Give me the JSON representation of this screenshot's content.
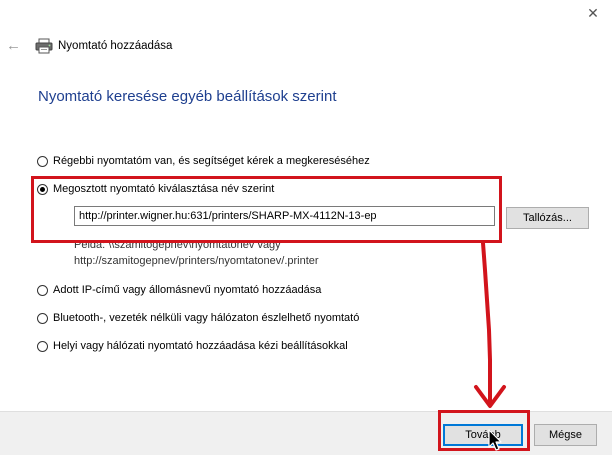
{
  "window": {
    "title": "Nyomtató hozzáadása",
    "close_glyph": "✕",
    "back_glyph": "←"
  },
  "page": {
    "heading": "Nyomtató keresése egyéb beállítások szerint"
  },
  "options": [
    {
      "label": "Régebbi nyomtatóm van, és segítséget kérek a megkereséséhez",
      "checked": false
    },
    {
      "label": "Megosztott nyomtató kiválasztása név szerint",
      "checked": true
    },
    {
      "label": "Adott IP-című vagy állomásnevű nyomtató hozzáadása",
      "checked": false
    },
    {
      "label": "Bluetooth-, vezeték nélküli vagy hálózaton észlelhető nyomtató",
      "checked": false
    },
    {
      "label": "Helyi vagy hálózati nyomtató hozzáadása kézi beállításokkal",
      "checked": false
    }
  ],
  "shared_printer": {
    "url_value": "http://printer.wigner.hu:631/printers/SHARP-MX-4112N-13-ep",
    "browse_label": "Tallózás...",
    "example_line1": "Példa: \\\\szamitogepnev\\nyomtatonev vagy",
    "example_line2": "http://szamitogepnev/printers/nyomtatonev/.printer"
  },
  "footer": {
    "next_label": "Tovább",
    "cancel_label": "Mégse"
  },
  "annotation": {
    "highlight_color": "#d2141c"
  }
}
